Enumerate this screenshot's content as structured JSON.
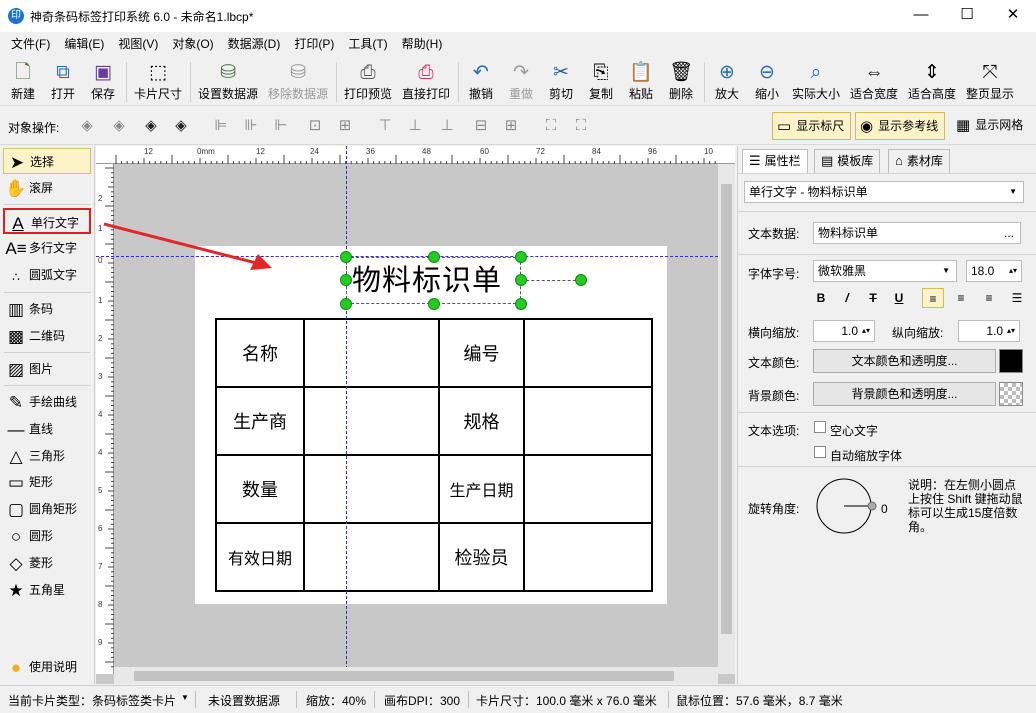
{
  "window": {
    "title": "神奇条码标签打印系统 6.0 - 未命名1.lbcp*",
    "app_icon": "印",
    "minimize": "—",
    "maximize": "☐",
    "close": "✕"
  },
  "menu": [
    "文件(F)",
    "编辑(E)",
    "视图(V)",
    "对象(O)",
    "数据源(D)",
    "打印(P)",
    "工具(T)",
    "帮助(H)"
  ],
  "toolbar": {
    "new": "新建",
    "open": "打开",
    "save": "保存",
    "card_size": "卡片尺寸",
    "set_datasource": "设置数据源",
    "remove_datasource": "移除数据源",
    "print_preview": "打印预览",
    "direct_print": "直接打印",
    "undo": "撤销",
    "redo": "重做",
    "cut": "剪切",
    "copy": "复制",
    "paste": "粘贴",
    "delete": "删除",
    "zoom_in": "放大",
    "zoom_out": "缩小",
    "actual_size": "实际大小",
    "fit_width": "适合宽度",
    "fit_height": "适合高度",
    "fit_page": "整页显示"
  },
  "object_bar": {
    "label": "对象操作:",
    "show_ruler": "显示标尺",
    "show_guides": "显示参考线",
    "show_grid": "显示网格"
  },
  "tools": {
    "select": "选择",
    "scroll": "滚屏",
    "single_text": "单行文字",
    "multi_text": "多行文字",
    "arc_text": "圆弧文字",
    "barcode": "条码",
    "qrcode": "二维码",
    "image": "图片",
    "freehand": "手绘曲线",
    "line": "直线",
    "triangle": "三角形",
    "rectangle": "矩形",
    "round_rect": "圆角矩形",
    "circle": "圆形",
    "diamond": "菱形",
    "star": "五角星",
    "help": "使用说明"
  },
  "ruler": {
    "h_ticks": [
      "12",
      "0mm",
      "12",
      "24",
      "36",
      "48",
      "60",
      "72",
      "84",
      "96",
      "10"
    ],
    "v_ticks": [
      "2",
      "1",
      "0",
      "1",
      "2",
      "3",
      "4",
      "4",
      "5",
      "6",
      "7",
      "8",
      "9"
    ]
  },
  "label": {
    "title": "物料标识单",
    "table": [
      [
        "名称",
        "",
        "编号",
        ""
      ],
      [
        "生产商",
        "",
        "规格",
        ""
      ],
      [
        "数量",
        "",
        "生产日期",
        ""
      ],
      [
        "有效日期",
        "",
        "检验员",
        ""
      ]
    ]
  },
  "panel": {
    "tabs": [
      "属性栏",
      "模板库",
      "素材库"
    ],
    "object_select": "单行文字 - 物料标识单",
    "text_data_label": "文本数据:",
    "text_data_value": "物料标识单",
    "more": "...",
    "font_label": "字体字号:",
    "font_name": "微软雅黑",
    "font_size": "18.0",
    "bold": "B",
    "italic": "/",
    "strike": "T",
    "underline": "U",
    "h_scale_label": "横向缩放:",
    "h_scale": "1.0",
    "v_scale_label": "纵向缩放:",
    "v_scale": "1.0",
    "text_color_label": "文本颜色:",
    "text_color_btn": "文本颜色和透明度...",
    "bg_color_label": "背景颜色:",
    "bg_color_btn": "背景颜色和透明度...",
    "text_color": "#000000",
    "options_label": "文本选项:",
    "hollow_text": "空心文字",
    "auto_shrink": "自动缩放字体",
    "rotation_label": "旋转角度:",
    "rotation_value": "0",
    "rotation_note": "说明：在左侧小圆点上按住 Shift 键拖动鼠标可以生成15度倍数角。"
  },
  "status": {
    "card_type": "当前卡片类型：条码标签类卡片",
    "datasource": "未设置数据源",
    "zoom": "缩放：40%",
    "dpi": "画布DPI：300",
    "card_size": "卡片尺寸：100.0 毫米 x 76.0 毫米",
    "mouse_pos": "鼠标位置：57.6 毫米，8.7 毫米"
  }
}
